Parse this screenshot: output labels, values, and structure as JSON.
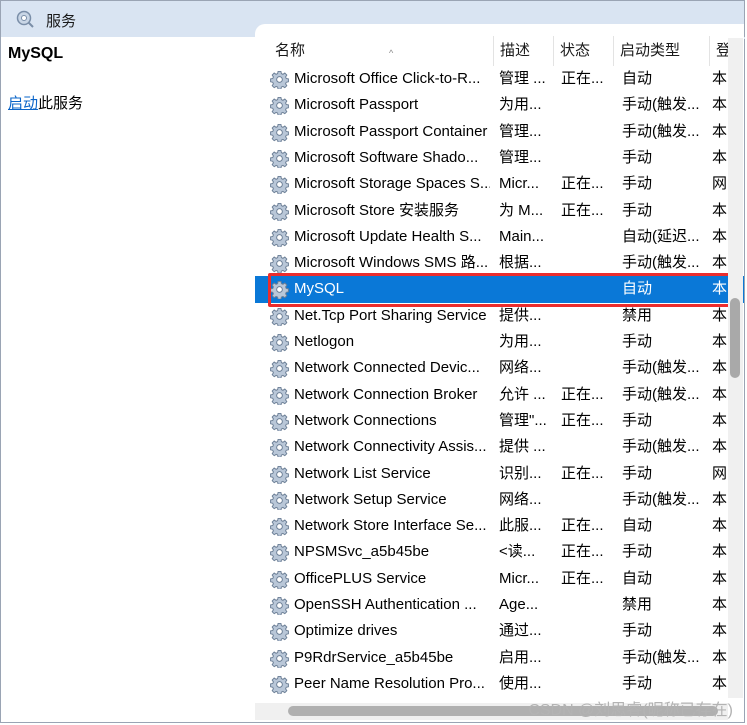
{
  "window": {
    "title": "服务"
  },
  "left": {
    "service_name": "MySQL",
    "action_link": "启动",
    "action_suffix": "此服务"
  },
  "columns": {
    "name": "名称",
    "desc": "描述",
    "status": "状态",
    "startup": "启动类型",
    "logon": "登"
  },
  "services": [
    {
      "name": "Microsoft Office Click-to-R...",
      "desc": "管理 ...",
      "status": "正在...",
      "startup": "自动",
      "logon": "本"
    },
    {
      "name": "Microsoft Passport",
      "desc": "为用...",
      "status": "",
      "startup": "手动(触发...",
      "logon": "本"
    },
    {
      "name": "Microsoft Passport Container",
      "desc": "管理...",
      "status": "",
      "startup": "手动(触发...",
      "logon": "本"
    },
    {
      "name": "Microsoft Software Shado...",
      "desc": "管理...",
      "status": "",
      "startup": "手动",
      "logon": "本"
    },
    {
      "name": "Microsoft Storage Spaces S...",
      "desc": "Micr...",
      "status": "正在...",
      "startup": "手动",
      "logon": "网"
    },
    {
      "name": "Microsoft Store 安装服务",
      "desc": "为 M...",
      "status": "正在...",
      "startup": "手动",
      "logon": "本"
    },
    {
      "name": "Microsoft Update Health S...",
      "desc": "Main...",
      "status": "",
      "startup": "自动(延迟...",
      "logon": "本"
    },
    {
      "name": "Microsoft Windows SMS 路...",
      "desc": "根据...",
      "status": "",
      "startup": "手动(触发...",
      "logon": "本"
    },
    {
      "name": "MySQL",
      "desc": "",
      "status": "",
      "startup": "自动",
      "logon": "本",
      "selected": true
    },
    {
      "name": "Net.Tcp Port Sharing Service",
      "desc": "提供...",
      "status": "",
      "startup": "禁用",
      "logon": "本"
    },
    {
      "name": "Netlogon",
      "desc": "为用...",
      "status": "",
      "startup": "手动",
      "logon": "本"
    },
    {
      "name": "Network Connected Devic...",
      "desc": "网络...",
      "status": "",
      "startup": "手动(触发...",
      "logon": "本"
    },
    {
      "name": "Network Connection Broker",
      "desc": "允许 ...",
      "status": "正在...",
      "startup": "手动(触发...",
      "logon": "本"
    },
    {
      "name": "Network Connections",
      "desc": "管理\"...",
      "status": "正在...",
      "startup": "手动",
      "logon": "本"
    },
    {
      "name": "Network Connectivity Assis...",
      "desc": "提供 ...",
      "status": "",
      "startup": "手动(触发...",
      "logon": "本"
    },
    {
      "name": "Network List Service",
      "desc": "识别...",
      "status": "正在...",
      "startup": "手动",
      "logon": "网"
    },
    {
      "name": "Network Setup Service",
      "desc": "网络...",
      "status": "",
      "startup": "手动(触发...",
      "logon": "本"
    },
    {
      "name": "Network Store Interface Se...",
      "desc": "此服...",
      "status": "正在...",
      "startup": "自动",
      "logon": "本"
    },
    {
      "name": "NPSMSvc_a5b45be",
      "desc": "<读...",
      "status": "正在...",
      "startup": "手动",
      "logon": "本"
    },
    {
      "name": "OfficePLUS Service",
      "desc": "Micr...",
      "status": "正在...",
      "startup": "自动",
      "logon": "本"
    },
    {
      "name": "OpenSSH Authentication ...",
      "desc": "Age...",
      "status": "",
      "startup": "禁用",
      "logon": "本"
    },
    {
      "name": "Optimize drives",
      "desc": "通过...",
      "status": "",
      "startup": "手动",
      "logon": "本"
    },
    {
      "name": "P9RdrService_a5b45be",
      "desc": "启用...",
      "status": "",
      "startup": "手动(触发...",
      "logon": "本"
    },
    {
      "name": "Peer Name Resolution Pro...",
      "desc": "使用...",
      "status": "",
      "startup": "手动",
      "logon": "本"
    }
  ],
  "watermark": "CSDN @刘思睿(昵称已存在)",
  "colors": {
    "selection": "#0a78d7",
    "highlight_box": "#ec2d2d",
    "title_bg": "#d9e4f2",
    "link": "#0a64c8"
  }
}
